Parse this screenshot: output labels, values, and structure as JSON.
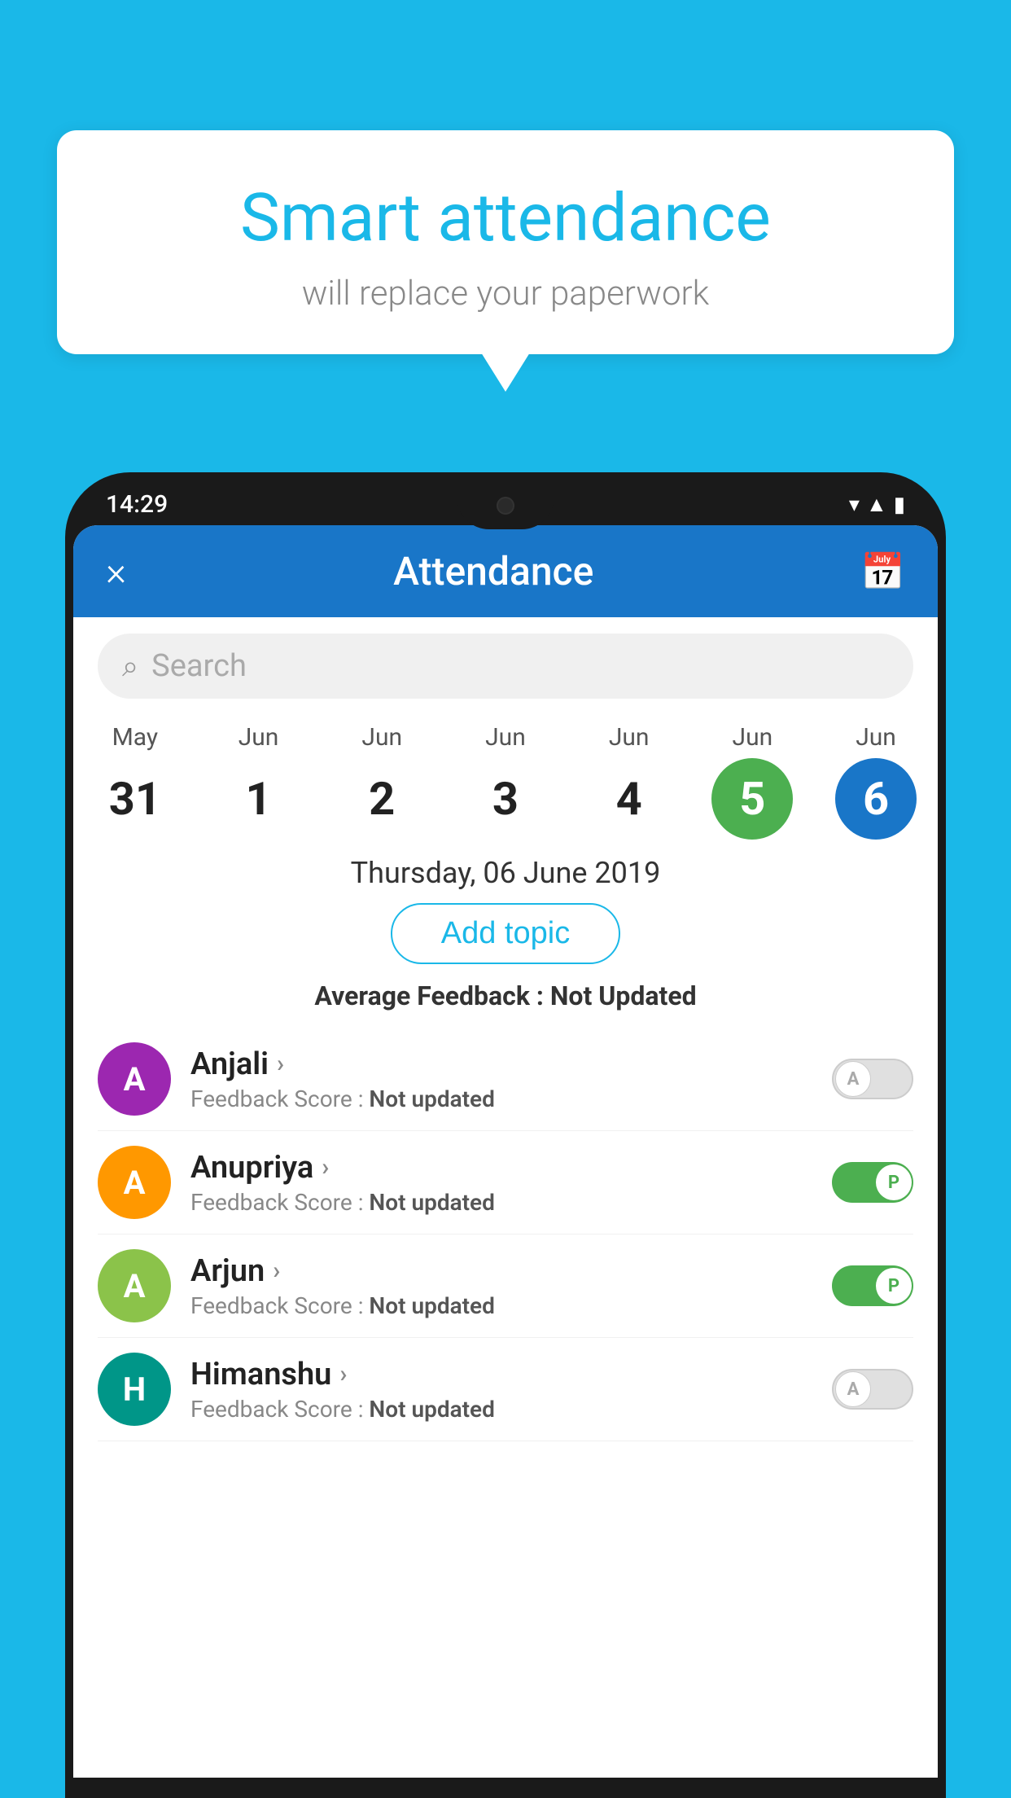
{
  "background_color": "#1ab8e8",
  "bubble": {
    "title": "Smart attendance",
    "subtitle": "will replace your paperwork"
  },
  "phone": {
    "status_bar": {
      "time": "14:29"
    },
    "header": {
      "close_label": "×",
      "title": "Attendance",
      "calendar_icon": "📅"
    },
    "search": {
      "placeholder": "Search"
    },
    "calendar": {
      "columns": [
        {
          "month": "May",
          "day": "31",
          "style": "normal"
        },
        {
          "month": "Jun",
          "day": "1",
          "style": "normal"
        },
        {
          "month": "Jun",
          "day": "2",
          "style": "normal"
        },
        {
          "month": "Jun",
          "day": "3",
          "style": "normal"
        },
        {
          "month": "Jun",
          "day": "4",
          "style": "normal"
        },
        {
          "month": "Jun",
          "day": "5",
          "style": "green"
        },
        {
          "month": "Jun",
          "day": "6",
          "style": "blue"
        }
      ]
    },
    "selected_date": "Thursday, 06 June 2019",
    "add_topic_label": "Add topic",
    "avg_feedback_label": "Average Feedback :",
    "avg_feedback_value": "Not Updated",
    "students": [
      {
        "name": "Anjali",
        "initial": "A",
        "avatar_color": "av-purple",
        "feedback_label": "Feedback Score :",
        "feedback_value": "Not updated",
        "toggle_state": "off",
        "toggle_letter": "A"
      },
      {
        "name": "Anupriya",
        "initial": "A",
        "avatar_color": "av-orange",
        "feedback_label": "Feedback Score :",
        "feedback_value": "Not updated",
        "toggle_state": "on",
        "toggle_letter": "P"
      },
      {
        "name": "Arjun",
        "initial": "A",
        "avatar_color": "av-light-green",
        "feedback_label": "Feedback Score :",
        "feedback_value": "Not updated",
        "toggle_state": "on",
        "toggle_letter": "P"
      },
      {
        "name": "Himanshu",
        "initial": "H",
        "avatar_color": "av-teal",
        "feedback_label": "Feedback Score :",
        "feedback_value": "Not updated",
        "toggle_state": "off",
        "toggle_letter": "A"
      }
    ]
  }
}
